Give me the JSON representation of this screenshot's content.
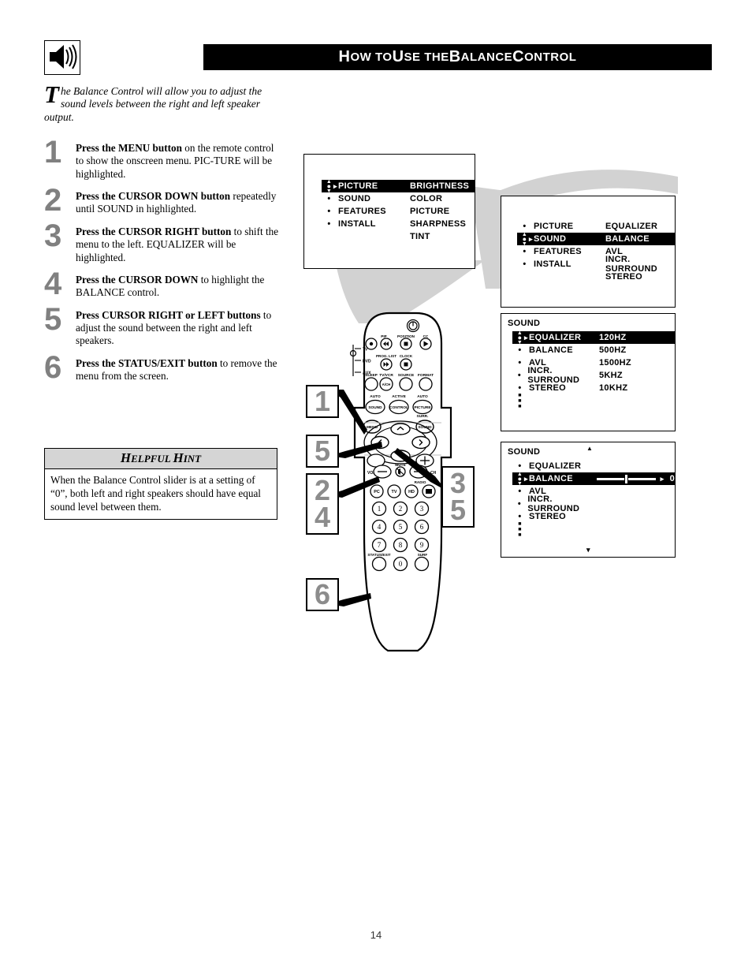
{
  "header": {
    "title_parts": [
      "H",
      "OW TO ",
      "U",
      "SE THE ",
      "B",
      "ALANCE ",
      "C",
      "ONTROL"
    ],
    "title_plain": "How to Use the Balance Control",
    "icon": "speaker-volume-icon"
  },
  "intro": {
    "dropcap": "T",
    "text": "he Balance Control will allow you to adjust the sound levels between the right and left speaker output."
  },
  "steps": [
    {
      "num": "1",
      "html": "<b>Press the MENU button</b> on the remote control to show the onscreen menu. PIC-TURE will be highlighted."
    },
    {
      "num": "2",
      "html": "<b>Press the CURSOR DOWN button</b> repeatedly until SOUND in highlighted."
    },
    {
      "num": "3",
      "html": "<b>Press the CURSOR RIGHT button</b> to shift the menu to the left. EQUALIZER will be highlighted."
    },
    {
      "num": "4",
      "html": "<b>Press the CURSOR DOWN</b> to highlight the BALANCE control."
    },
    {
      "num": "5",
      "html": "<b>Press CURSOR RIGHT or LEFT buttons</b> to adjust the sound between the right and left speakers."
    },
    {
      "num": "6",
      "html": "<b>Press the STATUS/EXIT button</b> to remove the menu from the screen."
    }
  ],
  "hint": {
    "title_parts": [
      "H",
      "ELPFUL ",
      "H",
      "INT"
    ],
    "title_plain": "Helpful Hint",
    "body": "When the Balance Control slider is at a setting of “0”, both left and right speakers should have equal sound level between them."
  },
  "osd1": {
    "left": [
      {
        "label": "PICTURE",
        "marker": "updown-arrow",
        "highlighted": true
      },
      {
        "label": "SOUND",
        "marker": "bullet",
        "highlighted": false
      },
      {
        "label": "FEATURES",
        "marker": "bullet",
        "highlighted": false
      },
      {
        "label": "INSTALL",
        "marker": "bullet",
        "highlighted": false
      }
    ],
    "right": [
      "BRIGHTNESS",
      "COLOR",
      "PICTURE",
      "SHARPNESS",
      "TINT"
    ]
  },
  "osd2": {
    "left": [
      {
        "label": "PICTURE",
        "marker": "bullet",
        "highlighted": false
      },
      {
        "label": "SOUND",
        "marker": "updown-arrow",
        "highlighted": true
      },
      {
        "label": "FEATURES",
        "marker": "bullet",
        "highlighted": false
      },
      {
        "label": "INSTALL",
        "marker": "bullet",
        "highlighted": false
      }
    ],
    "right": [
      "EQUALIZER",
      "BALANCE",
      "AVL",
      "INCR. SURROUND",
      "STEREO"
    ]
  },
  "osd3": {
    "title": "SOUND",
    "left": [
      {
        "label": "EQUALIZER",
        "marker": "updown-arrow",
        "highlighted": true
      },
      {
        "label": "BALANCE",
        "marker": "bullet",
        "highlighted": false
      },
      {
        "label": "AVL",
        "marker": "bullet",
        "highlighted": false
      },
      {
        "label": "INCR. SURROUND",
        "marker": "bullet",
        "highlighted": false
      },
      {
        "label": "STEREO",
        "marker": "bullet",
        "highlighted": false
      }
    ],
    "right": [
      "120HZ",
      "500HZ",
      "1500HZ",
      "5KHZ",
      "10KHZ"
    ],
    "more_indicator": "more-items-dots"
  },
  "osd4": {
    "title": "SOUND",
    "scroll_up": "scroll-up-arrow",
    "scroll_down": "scroll-down-arrow",
    "left": [
      {
        "label": "EQUALIZER",
        "marker": "bullet",
        "highlighted": false
      },
      {
        "label": "BALANCE",
        "marker": "updown-arrow",
        "highlighted": true
      },
      {
        "label": "AVL",
        "marker": "bullet",
        "highlighted": false
      },
      {
        "label": "INCR. SURROUND",
        "marker": "bullet",
        "highlighted": false
      },
      {
        "label": "STEREO",
        "marker": "bullet",
        "highlighted": false
      }
    ],
    "balance_value": "0",
    "more_indicator": "more-items-dots"
  },
  "remote": {
    "side_labels": [
      "TV",
      "DVD",
      "AUX"
    ],
    "power_icon": "power-icon",
    "row_top_labels": [
      "PIP",
      "POSITION",
      "CC"
    ],
    "row_top_buttons": [
      "record-icon",
      "rewind-icon",
      "stop-icon",
      "play-icon"
    ],
    "row2_labels": [
      "PROG. LIST",
      "CLOCK"
    ],
    "row2_buttons": [
      "fast-forward-icon",
      "stop-square-icon"
    ],
    "row3_labels": [
      "SLEEP",
      "TV/VCR",
      "SOURCE",
      "FORMAT"
    ],
    "row3_inner": [
      "A/CH"
    ],
    "row4_over": [
      "AUTO",
      "ACTIVE",
      "AUTO"
    ],
    "row4_labels": [
      "SOUND",
      "CONTROL",
      "PICTURE"
    ],
    "menu_label": "MENU",
    "sound_label": "SOUND",
    "surr_label": "SURR.",
    "cursor_icons": [
      "cursor-up-icon",
      "cursor-down-icon",
      "cursor-left-icon",
      "cursor-right-icon"
    ],
    "vol_label": "VOL",
    "ch_label": "CH",
    "mute_label": "MUTE",
    "mute_icon": "mute-icon",
    "source_row": [
      "PC",
      "TV",
      "HD"
    ],
    "radio_label": "RADIO",
    "radio_icon": "radio-icon",
    "keypad": [
      "1",
      "2",
      "3",
      "4",
      "5",
      "6",
      "7",
      "8",
      "9",
      "0"
    ],
    "status_exit_label": "STATUS/EXIT",
    "surf_label": "SURF"
  },
  "callouts": [
    {
      "id": "c1",
      "nums": [
        "1"
      ]
    },
    {
      "id": "c5",
      "nums": [
        "5"
      ]
    },
    {
      "id": "c24",
      "nums": [
        "2",
        "4"
      ]
    },
    {
      "id": "c35",
      "nums": [
        "3",
        "5"
      ]
    },
    {
      "id": "c6",
      "nums": [
        "6"
      ]
    }
  ],
  "footer": {
    "page_number": "14"
  }
}
